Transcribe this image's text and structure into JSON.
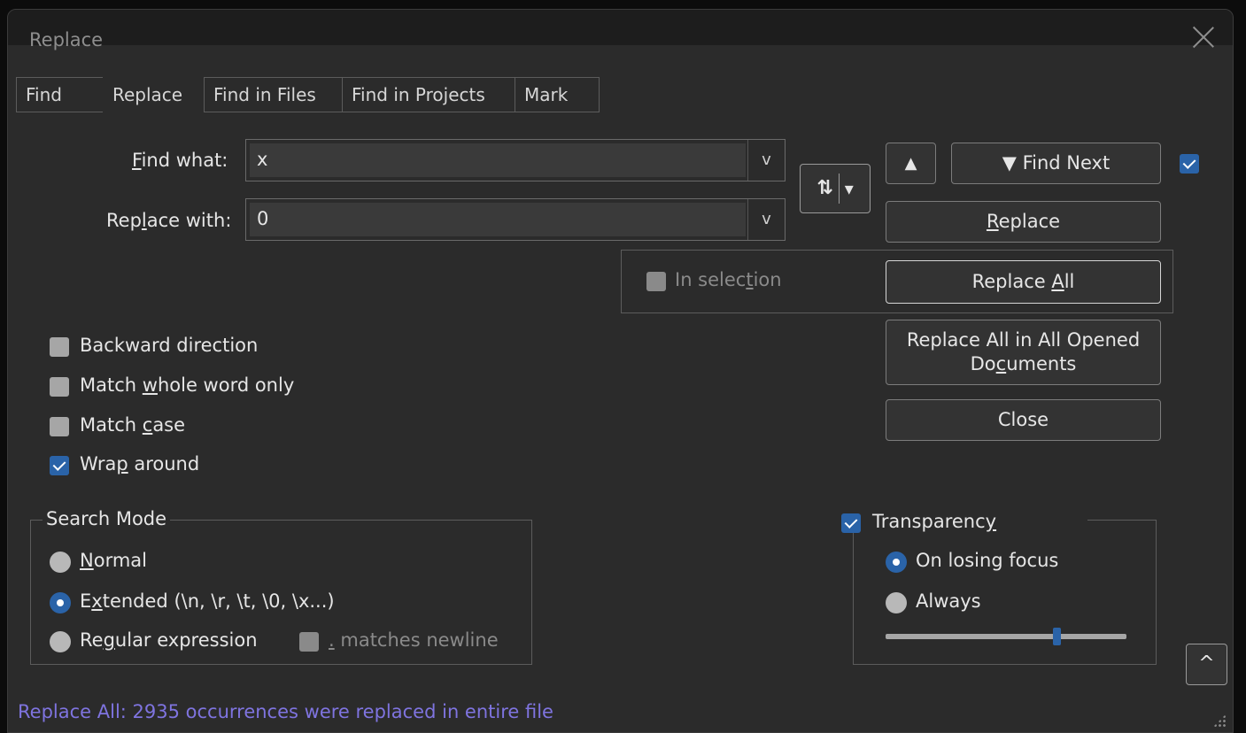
{
  "window": {
    "title": "Replace"
  },
  "tabs": [
    {
      "label": "Find"
    },
    {
      "label": "Replace"
    },
    {
      "label": "Find in Files"
    },
    {
      "label": "Find in Projects"
    },
    {
      "label": "Mark"
    }
  ],
  "find": {
    "label_pre": "",
    "label_key": "F",
    "label_post": "ind what:",
    "value": "x",
    "dropdown": "v"
  },
  "replace_field": {
    "label_pre": "Rep",
    "label_key": "l",
    "label_post": "ace with:",
    "value": "0",
    "dropdown": "v"
  },
  "swap": {
    "icon": "⇅",
    "menu": "▾"
  },
  "buttons": {
    "prev": "▲",
    "find_next": "▼ Find Next",
    "replace_pre": "",
    "replace_key": "R",
    "replace_post": "eplace",
    "replace_all_pre": "Replace ",
    "replace_all_key": "A",
    "replace_all_post": "ll",
    "replace_all_docs_line1": "Replace All in All Opened",
    "replace_all_docs_line2_pre": "Do",
    "replace_all_docs_line2_key": "c",
    "replace_all_docs_line2_post": "uments",
    "close": "Close",
    "collapse": "^"
  },
  "in_selection": {
    "pre": "In selec",
    "key": "t",
    "post": "ion",
    "checked": false
  },
  "options": {
    "backward": {
      "label": "Backward direction",
      "checked": false
    },
    "whole_word": {
      "pre": "Match ",
      "key": "w",
      "post": "hole word only",
      "checked": false
    },
    "match_case": {
      "pre": "Match ",
      "key": "c",
      "post": "ase",
      "checked": false
    },
    "wrap": {
      "pre": "Wra",
      "key": "p",
      "post": " around",
      "checked": true
    }
  },
  "search_mode": {
    "legend": "Search Mode",
    "normal": {
      "pre": "",
      "key": "N",
      "post": "ormal"
    },
    "extended": {
      "pre": "E",
      "key": "x",
      "post": "tended (\\n, \\r, \\t, \\0, \\x...)"
    },
    "regex": {
      "pre": "Re",
      "key": "g",
      "post": "ular expression"
    },
    "dot_newline": {
      "key": ".",
      "post": " matches newline"
    },
    "selected": "extended"
  },
  "transparency": {
    "pre": "Transparenc",
    "key": "y",
    "post": "",
    "checked": true,
    "on_losing_focus": "On losing focus",
    "always": "Always",
    "selected": "on_losing_focus",
    "slider_value": 0.71
  },
  "status": {
    "text": "Replace All: 2935 occurrences were replaced in entire file",
    "color": "#7f74e0"
  },
  "colors": {
    "accent": "#2a63a8",
    "background": "#2b2b2b"
  }
}
